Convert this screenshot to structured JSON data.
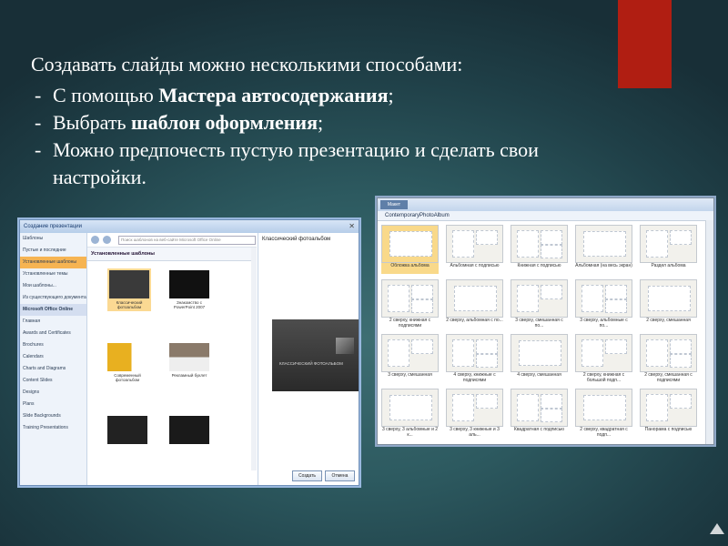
{
  "heading": "Создавать  слайды можно несколькими способами:",
  "bullets": [
    {
      "prefix": "С помощью ",
      "bold": "Мастера автосодержания",
      "suffix": ";"
    },
    {
      "prefix": "Выбрать ",
      "bold": "шаблон оформления",
      "suffix": ";"
    },
    {
      "prefix": "Можно предпочесть пустую презентацию и сделать свои",
      "bold": "",
      "suffix": ""
    }
  ],
  "bullet_continuation": "настройки.",
  "colors": {
    "accent": "#b01e12",
    "background": "#2d5a60"
  },
  "new_dialog": {
    "title": "Создание презентации",
    "search_placeholder": "Поиск шаблонов на веб-сайте Microsoft Office Online",
    "sidebar": [
      "Шаблоны",
      "Пустые и последние",
      "Установленные шаблоны",
      "Установленные темы",
      "Мои шаблоны...",
      "Из существующего документа...",
      "Microsoft Office Online",
      "Главная",
      "Awards and Certificates",
      "Brochures",
      "Calendars",
      "Charts and Diagrams",
      "Content Slides",
      "Designs",
      "Plans",
      "Slide Backgrounds",
      "Training Presentations"
    ],
    "section_title": "Установленные шаблоны",
    "templates": [
      "Классический фотоальбом",
      "Знакомство с PowerPoint 2007",
      "Современный фотоальбом",
      "Рекламный буклет",
      "",
      ""
    ],
    "preview_title": "Классический фотоальбом",
    "preview_text": "КЛАССИЧЕСКИЙ ФОТОАЛЬБОМ",
    "create_button": "Создать",
    "cancel_button": "Отмена"
  },
  "layout_window": {
    "menu_button": "Макет",
    "header": "ContemporaryPhotoAlbum",
    "layouts": [
      "Обложка альбома",
      "Альбомная с подписью",
      "Книжная с подписью",
      "Альбомная (на весь экран)",
      "Раздел альбома",
      "2 сверху, книжная с подписями",
      "2 сверху, альбомная с по...",
      "3 сверху, смешанная с по...",
      "3 сверху, альбомные с по...",
      "2 сверху, смешанная",
      "3 сверху, смешанная",
      "4 сверху, книжные с подписями",
      "4 сверху, смешанная",
      "2 сверху, книжная с большой подп...",
      "2 сверху, смешанная с подписями",
      "3 сверху, 3 альбомные и 2 к...",
      "3 сверху, 3 книжные и 3 аль...",
      "Квадратная с подписью",
      "2 сверху, квадратная с подп...",
      "Панорама с подписью"
    ]
  }
}
